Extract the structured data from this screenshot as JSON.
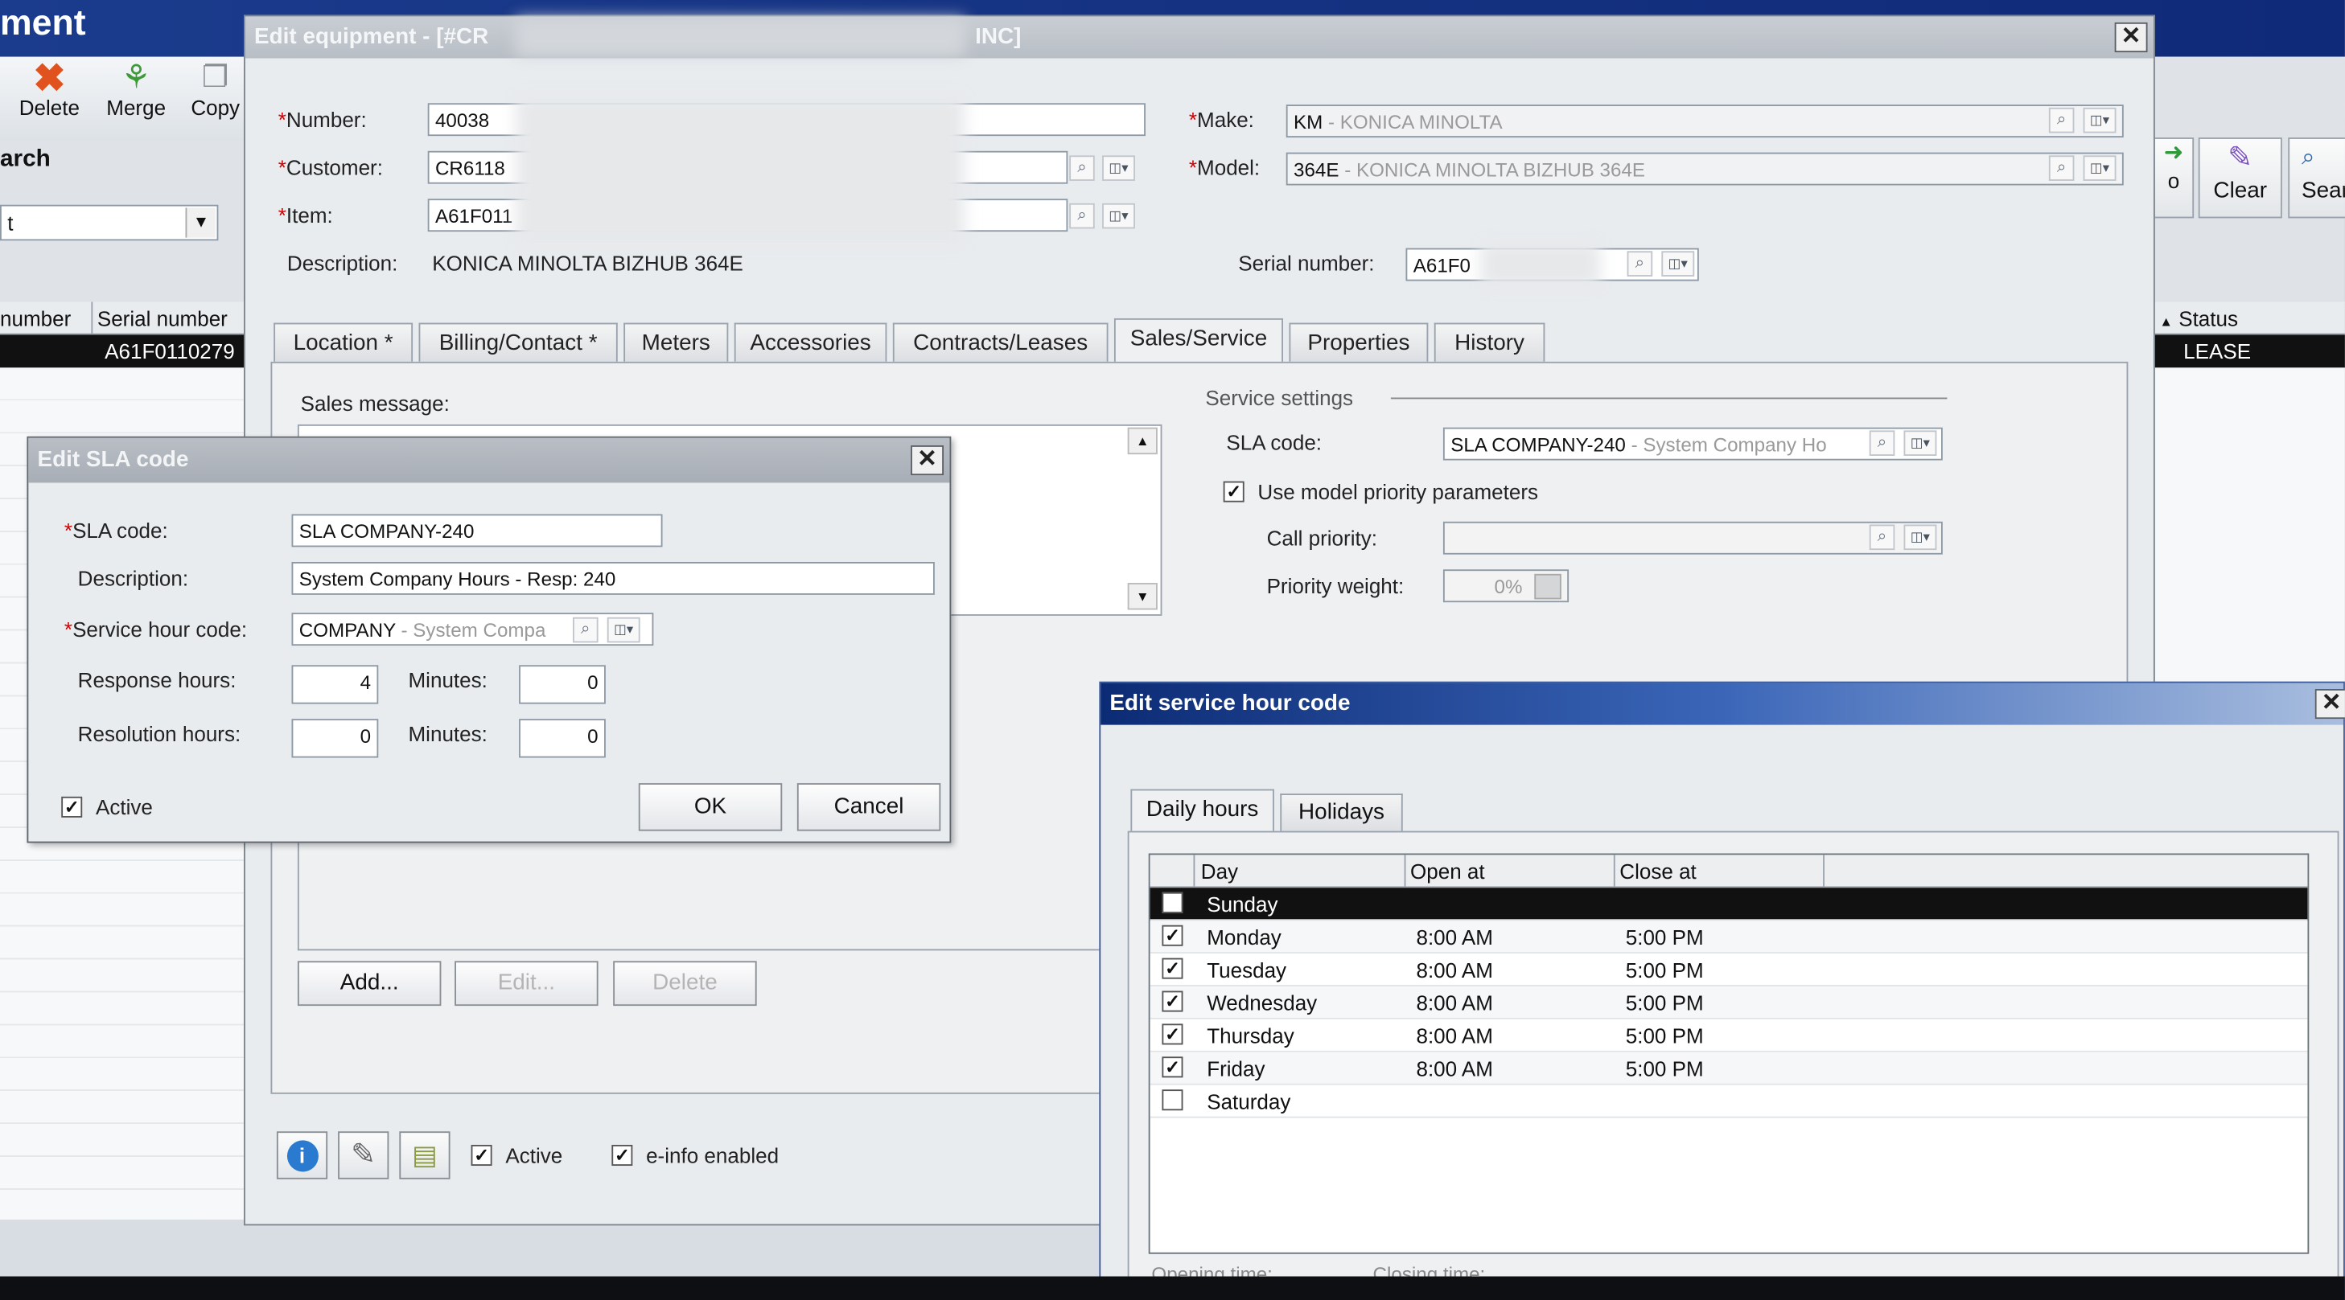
{
  "app": {
    "title_fragment": "ment",
    "toolbar": {
      "delete": "Delete",
      "merge": "Merge",
      "copy": "Copy",
      "clear": "Clear",
      "search_fragment": "Sear",
      "go_fragment": "o"
    },
    "search_label": "arch",
    "search_value": "t",
    "grid_headers": {
      "number": "number",
      "serial": "Serial number",
      "status": "Status"
    },
    "grid_row": {
      "serial": "A61F0110279",
      "status": "LEASE"
    }
  },
  "equipment": {
    "title": "Edit equipment - [#CR",
    "title_end": "INC]",
    "number_label": "Number:",
    "number": "40038",
    "customer_label": "Customer:",
    "customer": "CR6118",
    "item_label": "Item:",
    "item": "A61F011",
    "description_label": "Description:",
    "description": "KONICA MINOLTA BIZHUB 364E",
    "make_label": "Make:",
    "make_code": "KM",
    "make_desc": " - KONICA MINOLTA",
    "model_label": "Model:",
    "model_code": "364E",
    "model_desc": " - KONICA MINOLTA BIZHUB 364E",
    "serial_label": "Serial number:",
    "serial": "A61F0",
    "tabs": [
      "Location *",
      "Billing/Contact *",
      "Meters",
      "Accessories",
      "Contracts/Leases",
      "Sales/Service",
      "Properties",
      "History"
    ],
    "sales_message_label": "Sales message:",
    "service_settings_label": "Service settings",
    "sla_label": "SLA code:",
    "sla_code": "SLA COMPANY-240",
    "sla_desc": " - System Company Ho",
    "use_model_priority": "Use model priority parameters",
    "call_priority_label": "Call priority:",
    "priority_weight_label": "Priority weight:",
    "priority_weight": "0%",
    "add": "Add...",
    "edit": "Edit...",
    "delete": "Delete",
    "active": "Active",
    "einfo": "e-info enabled"
  },
  "sla_dialog": {
    "title": "Edit SLA code",
    "sla_label": "SLA code:",
    "sla_value": "SLA COMPANY-240",
    "description_label": "Description:",
    "description": "System Company Hours - Resp: 240",
    "service_hour_label": "Service hour code:",
    "service_hour_code": "COMPANY",
    "service_hour_desc": " - System Compa",
    "response_hours_label": "Response hours:",
    "response_hours": "4",
    "minutes_label": "Minutes:",
    "response_minutes": "0",
    "resolution_hours_label": "Resolution hours:",
    "resolution_hours": "0",
    "resolution_minutes": "0",
    "active": "Active",
    "ok": "OK",
    "cancel": "Cancel"
  },
  "service_hour_dialog": {
    "title": "Edit service hour code",
    "tabs": [
      "Daily hours",
      "Holidays"
    ],
    "columns": [
      "Day",
      "Open at",
      "Close at"
    ],
    "rows": [
      {
        "day": "Sunday",
        "open": "",
        "close": "",
        "checked": false,
        "selected": true
      },
      {
        "day": "Monday",
        "open": "8:00 AM",
        "close": "5:00 PM",
        "checked": true,
        "selected": false
      },
      {
        "day": "Tuesday",
        "open": "8:00 AM",
        "close": "5:00 PM",
        "checked": true,
        "selected": false
      },
      {
        "day": "Wednesday",
        "open": "8:00 AM",
        "close": "5:00 PM",
        "checked": true,
        "selected": false
      },
      {
        "day": "Thursday",
        "open": "8:00 AM",
        "close": "5:00 PM",
        "checked": true,
        "selected": false
      },
      {
        "day": "Friday",
        "open": "8:00 AM",
        "close": "5:00 PM",
        "checked": true,
        "selected": false
      },
      {
        "day": "Saturday",
        "open": "",
        "close": "",
        "checked": false,
        "selected": false
      }
    ],
    "opening_time_label": "Opening time:",
    "closing_time_label": "Closing time:"
  }
}
